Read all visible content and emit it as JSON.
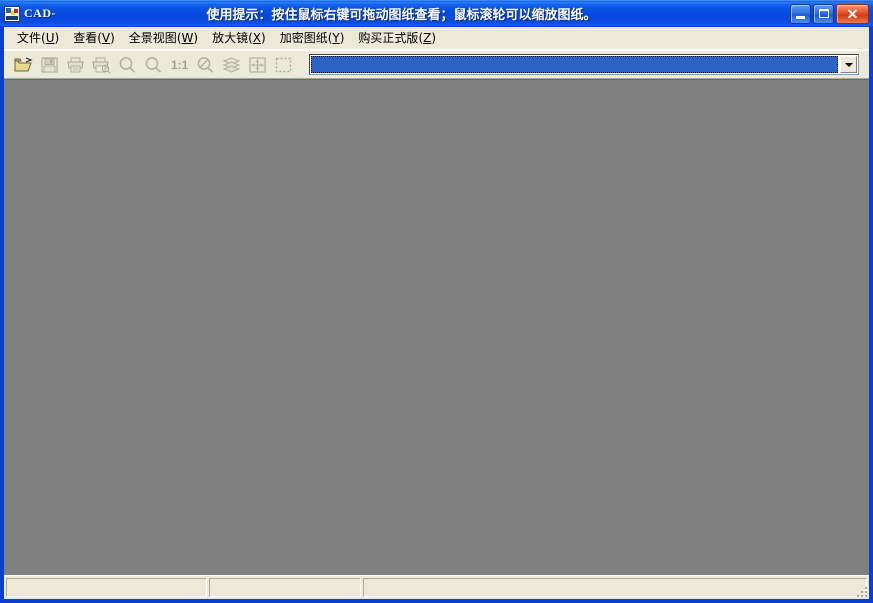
{
  "window": {
    "app_icon": "cad-app-icon",
    "title": "CAD-",
    "hint": "使用提示：按住鼠标右键可拖动图纸查看；鼠标滚轮可以缩放图纸。",
    "controls": {
      "minimize": "minimize-icon",
      "maximize": "maximize-icon",
      "close": "close-icon"
    }
  },
  "menubar": {
    "items": [
      {
        "label": "文件",
        "accel": "U"
      },
      {
        "label": "查看",
        "accel": "V"
      },
      {
        "label": "全景视图",
        "accel": "W"
      },
      {
        "label": "放大镜",
        "accel": "X"
      },
      {
        "label": "加密图纸",
        "accel": "Y"
      },
      {
        "label": "购买正式版",
        "accel": "Z"
      }
    ]
  },
  "toolbar": {
    "buttons": [
      {
        "icon": "open-folder-icon",
        "enabled": true
      },
      {
        "icon": "save-disk-icon",
        "enabled": false
      },
      {
        "icon": "print-icon",
        "enabled": false
      },
      {
        "icon": "print-preview-icon",
        "enabled": false
      },
      {
        "icon": "zoom-in-icon",
        "enabled": false
      },
      {
        "icon": "zoom-out-icon",
        "enabled": false
      },
      {
        "icon": "zoom-actual-size-icon",
        "enabled": false,
        "label": "1:1"
      },
      {
        "icon": "zoom-cancel-icon",
        "enabled": false
      },
      {
        "icon": "layers-icon",
        "enabled": false
      },
      {
        "icon": "fit-to-window-icon",
        "enabled": false
      },
      {
        "icon": "select-region-icon",
        "enabled": false
      }
    ],
    "combo": {
      "value": "",
      "placeholder": "",
      "arrow_icon": "chevron-down-icon"
    }
  },
  "canvas": {
    "background_color": "#808080",
    "content": ""
  },
  "statusbar": {
    "panels": [
      "",
      "",
      ""
    ],
    "grip_icon": "resize-grip-icon"
  },
  "colors": {
    "titlebar_blue": "#0A4FE0",
    "window_border": "#0A3FD4",
    "chrome": "#ECE9D8",
    "canvas_gray": "#808080",
    "combo_select": "#2A63C4",
    "close_red": "#E8552A"
  }
}
